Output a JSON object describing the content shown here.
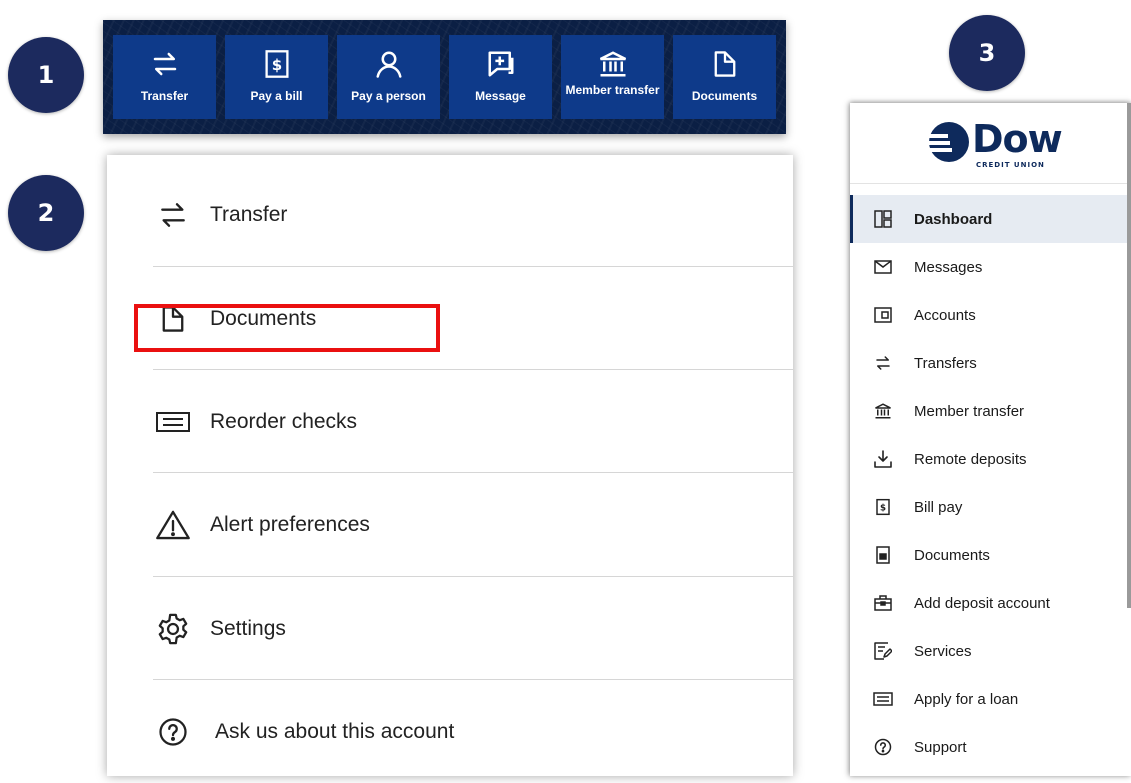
{
  "badges": [
    "1",
    "2",
    "3"
  ],
  "quick_actions": [
    {
      "label": "Transfer",
      "icon": "transfer-icon"
    },
    {
      "label": "Pay a bill",
      "icon": "bill-icon"
    },
    {
      "label": "Pay a person",
      "icon": "person-icon"
    },
    {
      "label": "Message",
      "icon": "message-icon"
    },
    {
      "label": "Member transfer",
      "icon": "bank-icon"
    },
    {
      "label": "Documents",
      "icon": "document-icon"
    }
  ],
  "menu": [
    {
      "label": "Transfer",
      "icon": "transfer-icon"
    },
    {
      "label": "Documents",
      "icon": "document-icon",
      "highlighted": true
    },
    {
      "label": "Reorder checks",
      "icon": "checks-icon"
    },
    {
      "label": "Alert preferences",
      "icon": "warning-icon"
    },
    {
      "label": "Settings",
      "icon": "gear-icon"
    },
    {
      "label": "Ask us about this account",
      "icon": "help-icon"
    }
  ],
  "sidebar": {
    "brand": {
      "name": "Dow",
      "tagline": "CREDIT UNION"
    },
    "items": [
      {
        "label": "Dashboard",
        "icon": "dashboard-icon",
        "active": true
      },
      {
        "label": "Messages",
        "icon": "mail-icon"
      },
      {
        "label": "Accounts",
        "icon": "wallet-icon"
      },
      {
        "label": "Transfers",
        "icon": "transfer-icon"
      },
      {
        "label": "Member transfer",
        "icon": "bank-icon"
      },
      {
        "label": "Remote deposits",
        "icon": "download-icon"
      },
      {
        "label": "Bill pay",
        "icon": "bill-icon"
      },
      {
        "label": "Documents",
        "icon": "document-icon"
      },
      {
        "label": "Add deposit account",
        "icon": "briefcase-icon"
      },
      {
        "label": "Services",
        "icon": "edit-icon"
      },
      {
        "label": "Apply for a loan",
        "icon": "card-icon"
      },
      {
        "label": "Support",
        "icon": "help-icon"
      }
    ]
  },
  "colors": {
    "badge": "#1c2a5e",
    "quick_bar_bg": "#0b1f44",
    "quick_button": "#0e3a8a",
    "highlight_border": "#ea1010",
    "active_item_bg": "#e6ebf2",
    "brand_navy": "#0e2a5c"
  }
}
